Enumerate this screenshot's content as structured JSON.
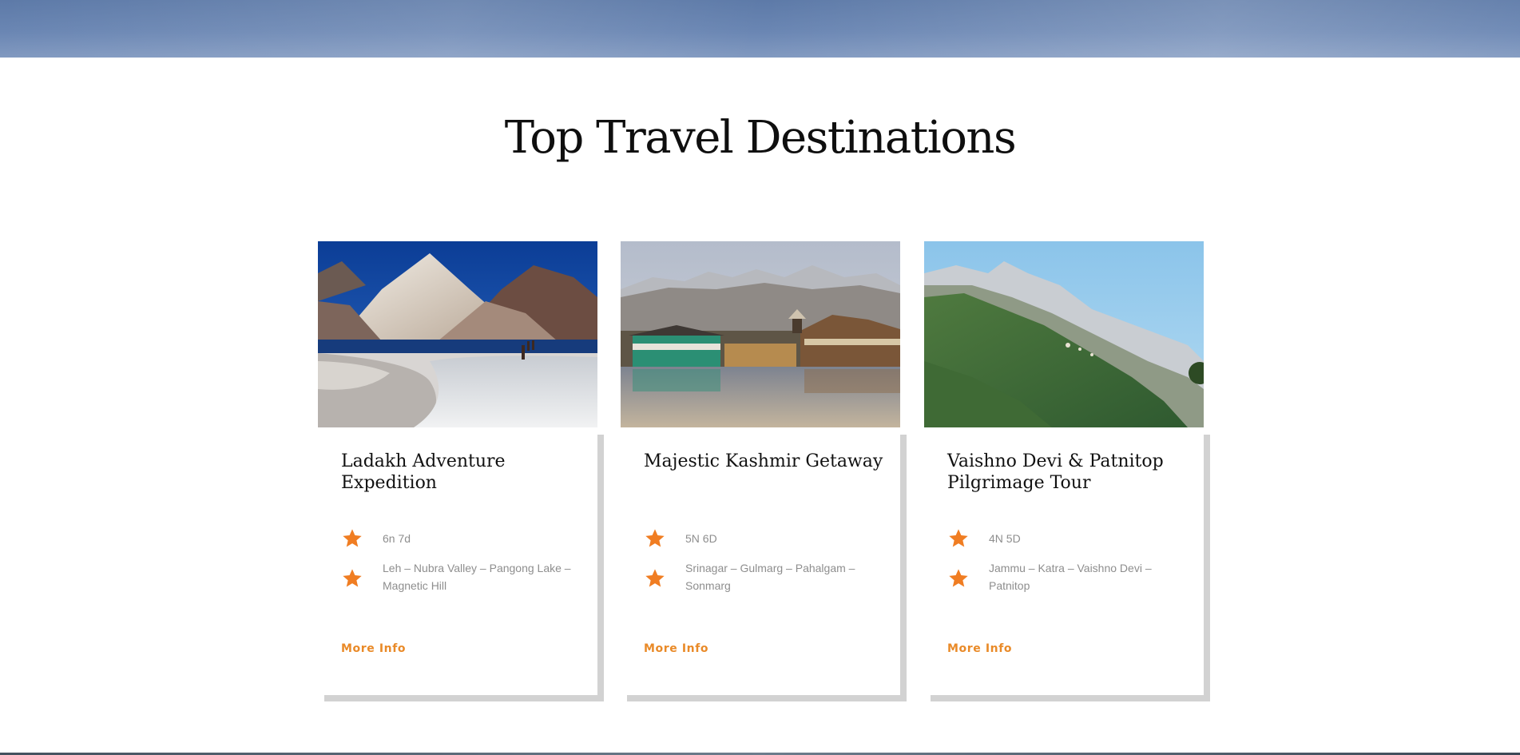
{
  "section": {
    "title": "Top Travel Destinations"
  },
  "cards": [
    {
      "title": "Ladakh Adventure Expedition",
      "image": "lake-mountain-photo",
      "details": [
        {
          "icon": "star-icon",
          "text": "6n 7d"
        },
        {
          "icon": "star-icon",
          "text": "Leh – Nubra Valley – Pangong Lake – Magnetic Hill"
        }
      ],
      "link": "More Info"
    },
    {
      "title": "Majestic Kashmir Getaway",
      "image": "houseboat-lake-photo",
      "details": [
        {
          "icon": "star-icon",
          "text": "5N 6D"
        },
        {
          "icon": "star-icon",
          "text": "Srinagar – Gulmarg – Pahalgam – Sonmarg"
        }
      ],
      "link": "More Info"
    },
    {
      "title": "Vaishno Devi & Patnitop Pilgrimage Tour",
      "image": "green-mountain-photo",
      "details": [
        {
          "icon": "star-icon",
          "text": "4N 5D"
        },
        {
          "icon": "star-icon",
          "text": "Jammu – Katra – Vaishno Devi – Patnitop"
        }
      ],
      "link": "More Info"
    }
  ],
  "colors": {
    "accent": "#e98a28",
    "muted_text": "#8e8e8e",
    "shadow": "#d2d2d2"
  }
}
